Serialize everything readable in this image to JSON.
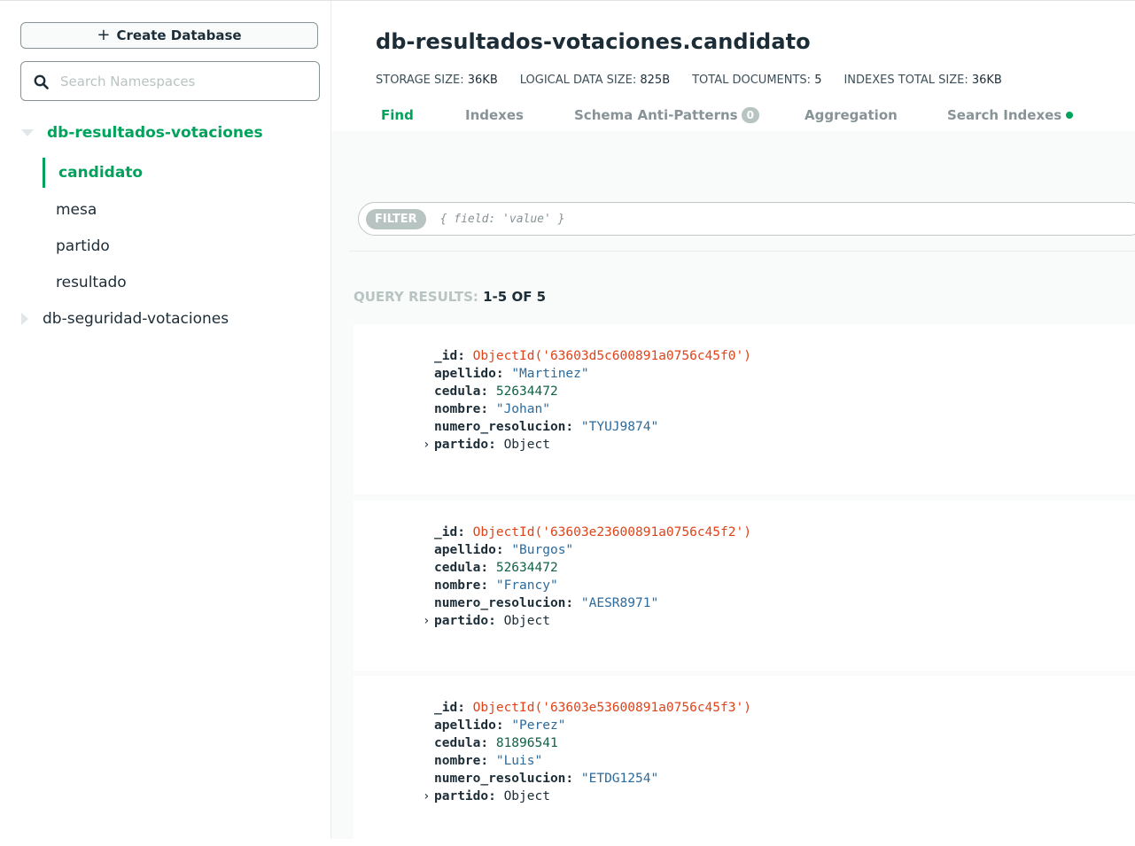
{
  "sidebar": {
    "create_button_label": "Create Database",
    "search_placeholder": "Search Namespaces",
    "databases": [
      {
        "name": "db-resultados-votaciones",
        "expanded": true,
        "collections": [
          "candidato",
          "mesa",
          "partido",
          "resultado"
        ],
        "active_collection": "candidato"
      },
      {
        "name": "db-seguridad-votaciones",
        "expanded": false
      }
    ]
  },
  "header": {
    "title": "db-resultados-votaciones.candidato",
    "stats": {
      "storage_label": "STORAGE SIZE:",
      "storage_value": "36KB",
      "logical_label": "LOGICAL DATA SIZE:",
      "logical_value": "825B",
      "docs_label": "TOTAL DOCUMENTS:",
      "docs_value": "5",
      "indexes_label": "INDEXES TOTAL SIZE:",
      "indexes_value": "36KB"
    },
    "tabs": {
      "find": "Find",
      "indexes": "Indexes",
      "schema": "Schema Anti-Patterns",
      "schema_count": "0",
      "aggregation": "Aggregation",
      "search_indexes": "Search Indexes"
    }
  },
  "filter": {
    "label": "FILTER",
    "placeholder": "{ field: 'value' }"
  },
  "results": {
    "label": "QUERY RESULTS:",
    "range": "1-5 OF 5",
    "documents": [
      {
        "_id": "ObjectId('63603d5c600891a0756c45f0')",
        "apellido": "\"Martinez\"",
        "cedula": "52634472",
        "nombre": "\"Johan\"",
        "numero_resolucion": "\"TYUJ9874\"",
        "partido": "Object"
      },
      {
        "_id": "ObjectId('63603e23600891a0756c45f2')",
        "apellido": "\"Burgos\"",
        "cedula": "52634472",
        "nombre": "\"Francy\"",
        "numero_resolucion": "\"AESR8971\"",
        "partido": "Object"
      },
      {
        "_id": "ObjectId('63603e53600891a0756c45f3')",
        "apellido": "\"Perez\"",
        "cedula": "81896541",
        "nombre": "\"Luis\"",
        "numero_resolucion": "\"ETDG1254\"",
        "partido": "Object"
      }
    ]
  },
  "colors": {
    "accent": "#00a35c",
    "objectid": "#e0431a",
    "string": "#2c6a9b",
    "number": "#116149"
  },
  "icons": {
    "create": "plus-icon",
    "search": "search-icon",
    "expanded": "caret-down-icon",
    "collapsed": "caret-right-icon",
    "field_expander": "chevron-right-icon",
    "search_indexes_status": "status-dot-icon"
  }
}
